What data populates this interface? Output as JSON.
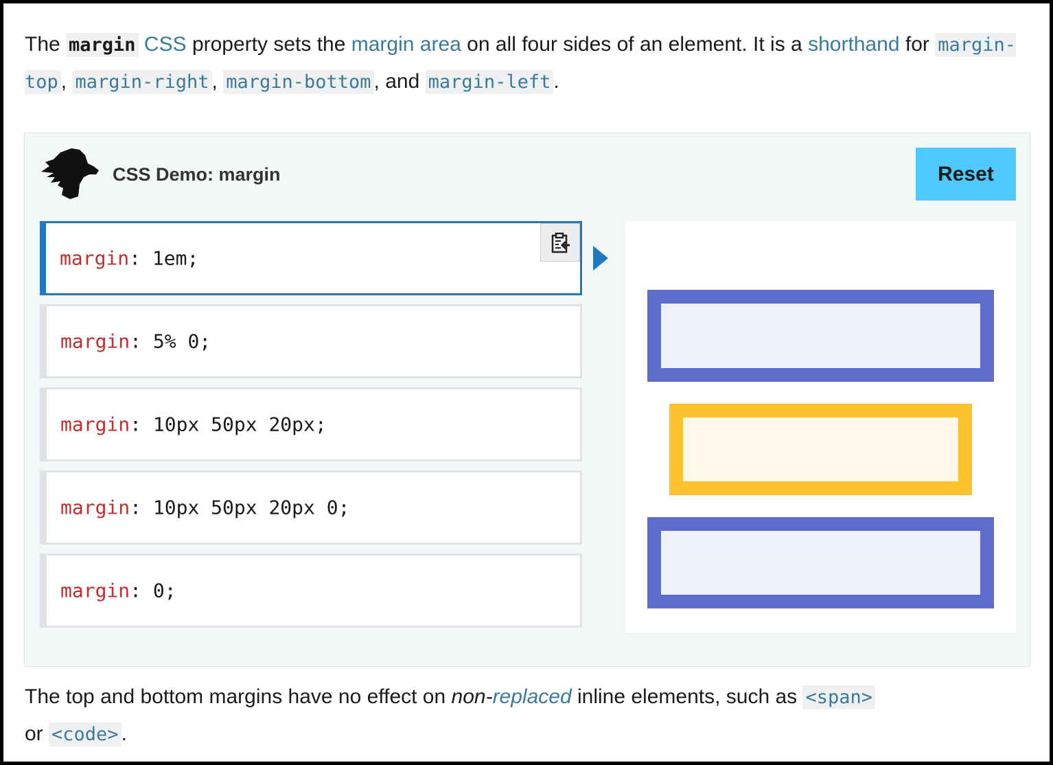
{
  "intro": {
    "t1": "The ",
    "code_margin": "margin",
    "t2": " ",
    "link_css": "CSS",
    "t3": " property sets the ",
    "link_margin_area": "margin area",
    "t4": " on all four sides of an element. It is a ",
    "link_shorthand": "shorthand",
    "t5": " for ",
    "code_top": "margin-top",
    "sep1": ", ",
    "code_right": "margin-right",
    "sep2": ", ",
    "code_bottom": "margin-bottom",
    "sep3": ", and ",
    "code_left": "margin-left",
    "t6": "."
  },
  "demo": {
    "title": "CSS Demo: margin",
    "reset_label": "Reset",
    "choices": [
      {
        "prop": "margin",
        "value": ": 1em;",
        "selected": true
      },
      {
        "prop": "margin",
        "value": ": 5% 0;"
      },
      {
        "prop": "margin",
        "value": ": 10px 50px 20px;"
      },
      {
        "prop": "margin",
        "value": ": 10px 50px 20px 0;"
      },
      {
        "prop": "margin",
        "value": ": 0;"
      }
    ],
    "copy_icon": "clipboard-icon",
    "colors": {
      "selected_border": "#2078c0",
      "reset_bg": "#4fc8fb",
      "box_blue_border": "#5e6dcd",
      "box_yellow_border": "#fcc12d",
      "property_red": "#c22d2d"
    }
  },
  "outro": {
    "t1": "The top and bottom margins have no effect on ",
    "em_non": "non-",
    "link_replaced": "replaced",
    "t2": " inline elements, such as ",
    "code_span": "<span>",
    "t3": " or ",
    "code_code": "<code>",
    "t4": "."
  }
}
